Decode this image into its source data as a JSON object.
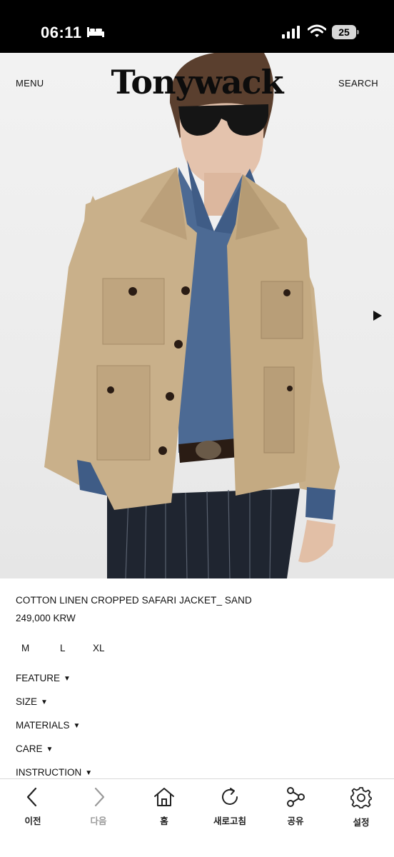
{
  "status_bar": {
    "time": "06:11",
    "battery": "25",
    "icons": [
      "sleep-icon",
      "signal-icon",
      "wifi-icon",
      "battery-icon"
    ]
  },
  "header": {
    "menu_label": "MENU",
    "brand": "Tonywack",
    "search_label": "SEARCH"
  },
  "hero": {
    "image_alt": "product-photo",
    "next_icon": "play-right-icon"
  },
  "product": {
    "name": "COTTON LINEN CROPPED SAFARI JACKET_ SAND",
    "price": "249,000 KRW",
    "sizes": [
      "M",
      "L",
      "XL"
    ]
  },
  "sections": [
    {
      "label": "FEATURE"
    },
    {
      "label": "SIZE"
    },
    {
      "label": "MATERIALS"
    },
    {
      "label": "CARE"
    },
    {
      "label": "INSTRUCTION"
    }
  ],
  "toolbar": {
    "items": [
      {
        "label": "이전",
        "icon": "chevron-left-icon"
      },
      {
        "label": "다음",
        "icon": "chevron-right-icon"
      },
      {
        "label": "홈",
        "icon": "home-icon"
      },
      {
        "label": "새로고침",
        "icon": "refresh-icon"
      },
      {
        "label": "공유",
        "icon": "share-icon"
      },
      {
        "label": "설정",
        "icon": "gear-icon"
      }
    ]
  },
  "colors": {
    "jacket": "#c9b08a",
    "shirt": "#4c6a94",
    "pants": "#1f2530",
    "background": "#ededed"
  }
}
